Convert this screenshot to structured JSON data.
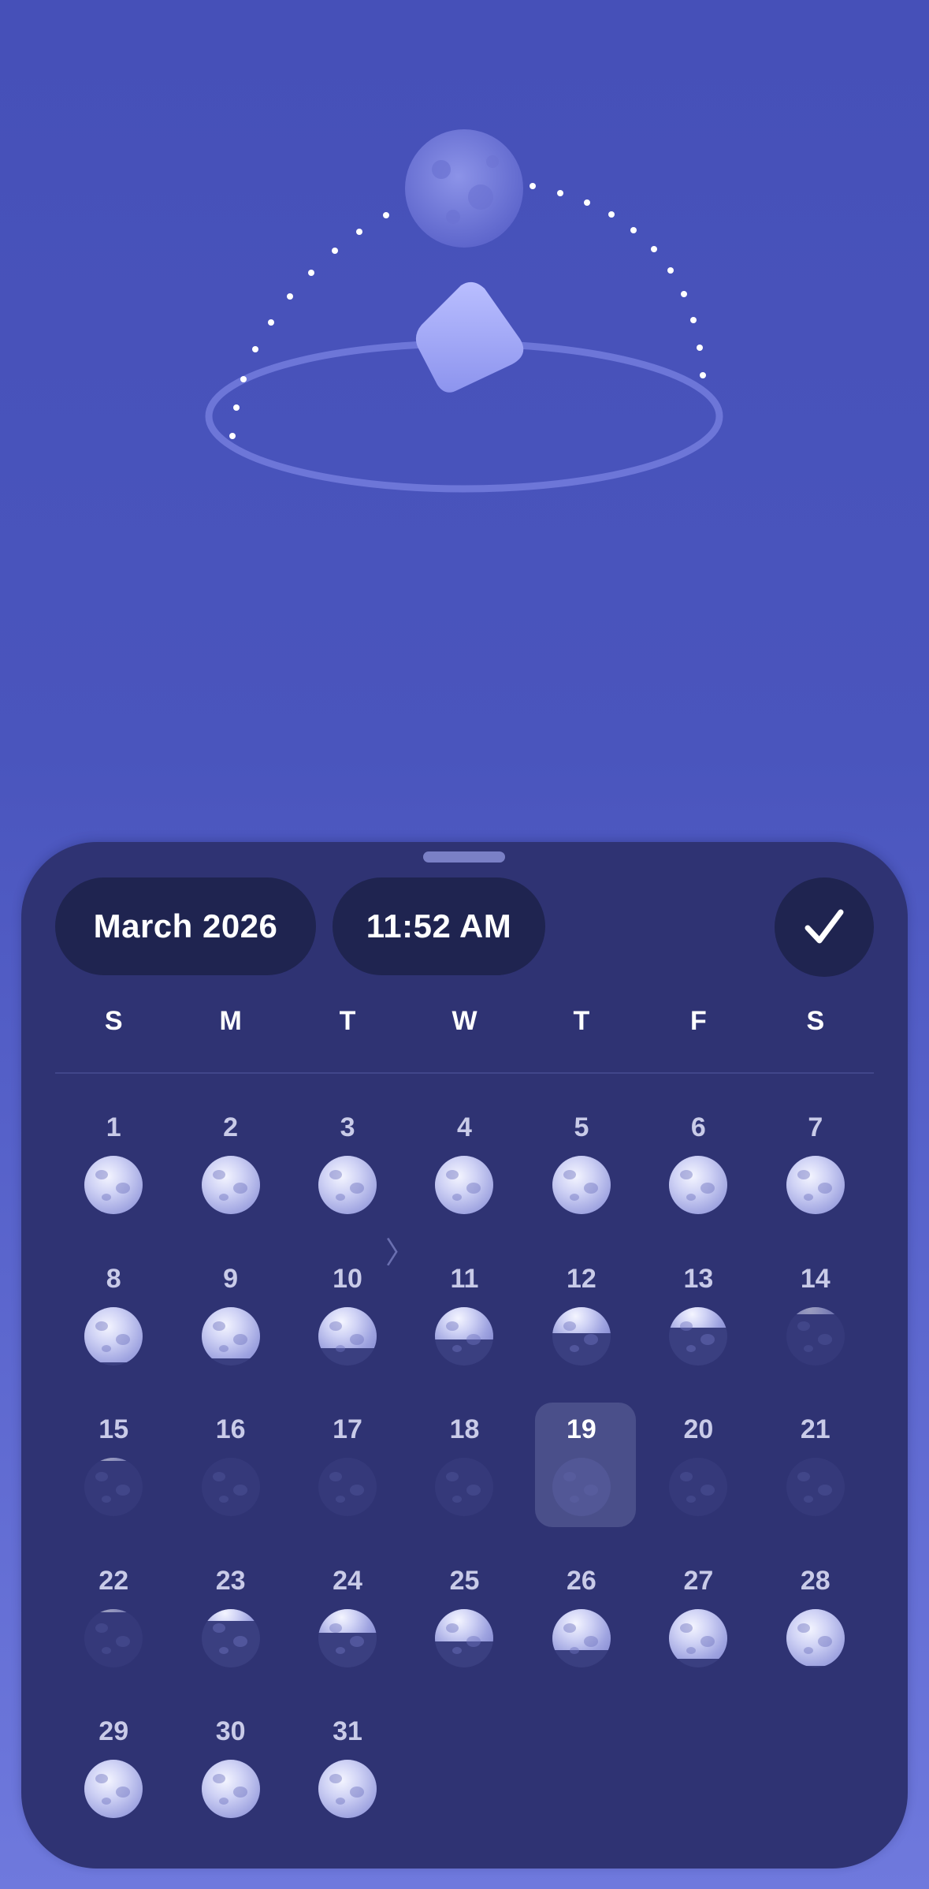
{
  "header": {
    "month_label": "March 2026",
    "time_label": "11:52 AM"
  },
  "weekdays": [
    "S",
    "M",
    "T",
    "W",
    "T",
    "F",
    "S"
  ],
  "calendar": {
    "days": [
      {
        "day": "1",
        "illumination": 1.0
      },
      {
        "day": "2",
        "illumination": 1.0
      },
      {
        "day": "3",
        "illumination": 1.0
      },
      {
        "day": "4",
        "illumination": 1.0
      },
      {
        "day": "5",
        "illumination": 1.0
      },
      {
        "day": "6",
        "illumination": 1.0
      },
      {
        "day": "7",
        "illumination": 1.0
      },
      {
        "day": "8",
        "illumination": 0.95
      },
      {
        "day": "9",
        "illumination": 0.88
      },
      {
        "day": "10",
        "illumination": 0.7
      },
      {
        "day": "11",
        "illumination": 0.55
      },
      {
        "day": "12",
        "illumination": 0.45
      },
      {
        "day": "13",
        "illumination": 0.35
      },
      {
        "day": "14",
        "illumination": 0.12
      },
      {
        "day": "15",
        "illumination": 0.06
      },
      {
        "day": "16",
        "illumination": 0.0
      },
      {
        "day": "17",
        "illumination": 0.0
      },
      {
        "day": "18",
        "illumination": 0.0
      },
      {
        "day": "19",
        "illumination": 0.0,
        "selected": true
      },
      {
        "day": "20",
        "illumination": 0.0
      },
      {
        "day": "21",
        "illumination": 0.0
      },
      {
        "day": "22",
        "illumination": 0.06
      },
      {
        "day": "23",
        "illumination": 0.2
      },
      {
        "day": "24",
        "illumination": 0.4
      },
      {
        "day": "25",
        "illumination": 0.55
      },
      {
        "day": "26",
        "illumination": 0.7
      },
      {
        "day": "27",
        "illumination": 0.85
      },
      {
        "day": "28",
        "illumination": 0.97
      },
      {
        "day": "29",
        "illumination": 1.0
      },
      {
        "day": "30",
        "illumination": 1.0
      },
      {
        "day": "31",
        "illumination": 1.0
      }
    ]
  },
  "icons": {
    "confirm": "checkmark-icon",
    "nav": "chevron-right-icon"
  },
  "colors": {
    "background_top": "#4650b8",
    "background_bottom": "#6f79dd",
    "sheet": "#2f3373",
    "pill": "#1f2450",
    "moon_lit": "#cfd2f5"
  }
}
